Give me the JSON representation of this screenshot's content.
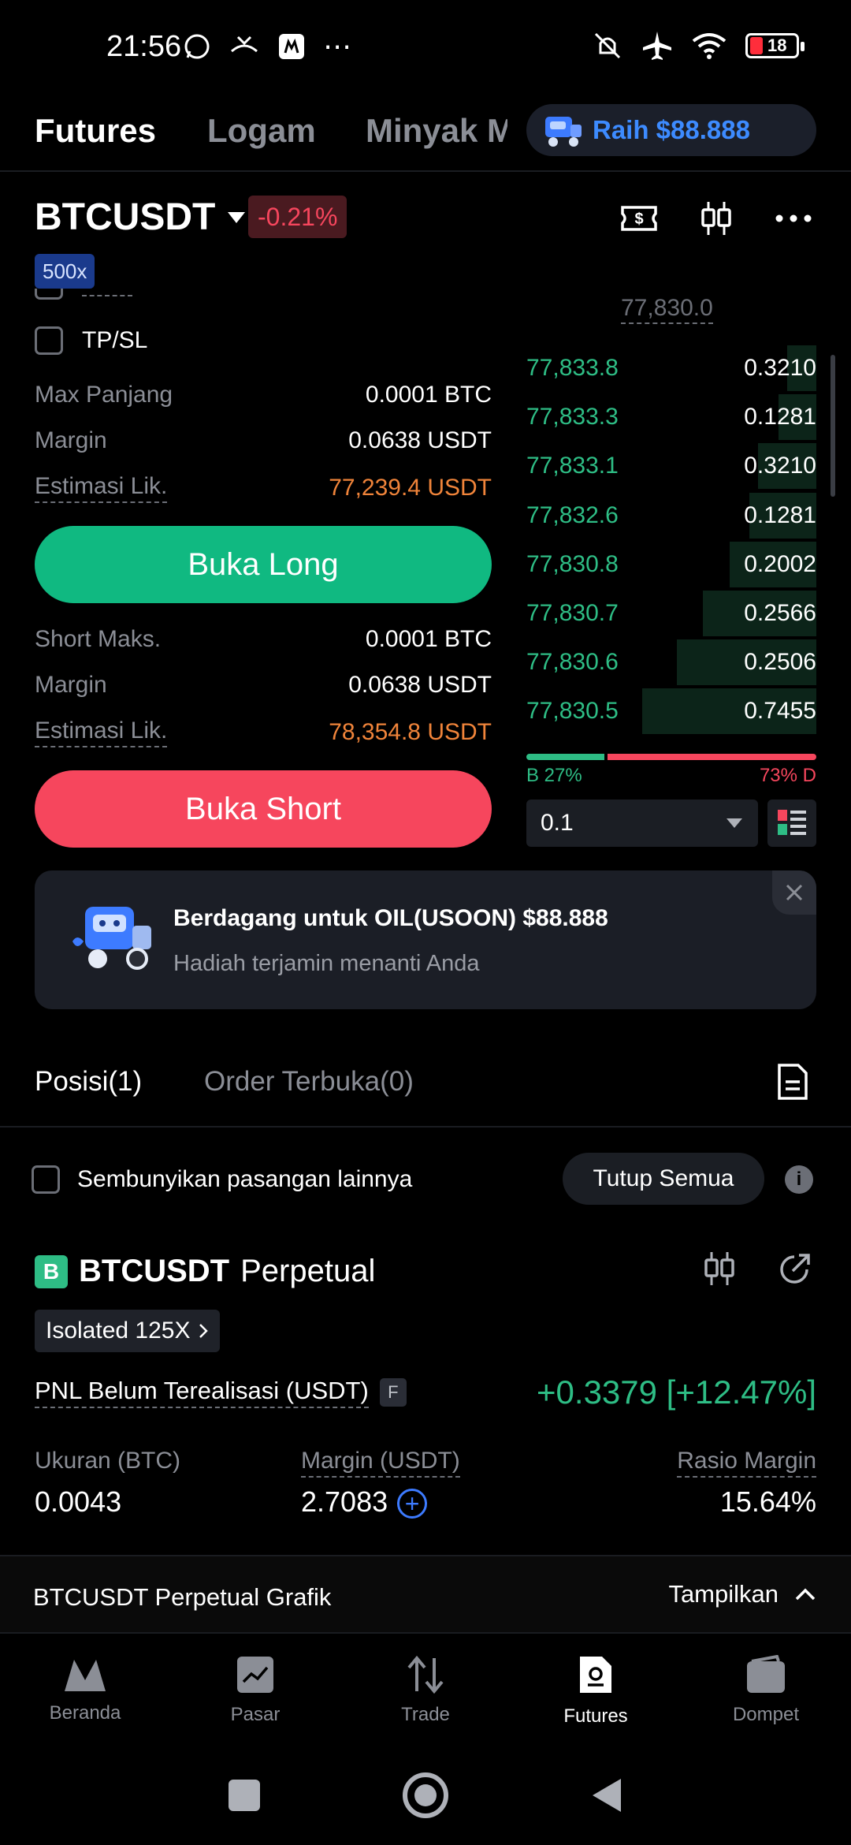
{
  "status_bar": {
    "time": "21:56",
    "battery": "18"
  },
  "top_tabs": {
    "tabs": [
      "Futures",
      "Logam",
      "Minyak M"
    ],
    "promo": "Raih $88.888"
  },
  "pair": {
    "symbol": "BTCUSDT",
    "change": "-0.21%",
    "leverage": "500x"
  },
  "form": {
    "tpsl_label": "TP/SL",
    "long": {
      "max_label": "Max Panjang",
      "max_value": "0.0001 BTC",
      "margin_label": "Margin",
      "margin_value": "0.0638 USDT",
      "liq_label": "Estimasi Lik.",
      "liq_value": "77,239.4 USDT",
      "button": "Buka Long"
    },
    "short": {
      "max_label": "Short Maks.",
      "max_value": "0.0001 BTC",
      "margin_label": "Margin",
      "margin_value": "0.0638 USDT",
      "liq_label": "Estimasi Lik.",
      "liq_value": "78,354.8 USDT",
      "button": "Buka Short"
    }
  },
  "orderbook": {
    "last_price": "77,830.0",
    "rows": [
      {
        "price": "77,833.8",
        "qty": "0.3210",
        "depth": 0.1
      },
      {
        "price": "77,833.3",
        "qty": "0.1281",
        "depth": 0.13
      },
      {
        "price": "77,833.1",
        "qty": "0.3210",
        "depth": 0.2
      },
      {
        "price": "77,832.6",
        "qty": "0.1281",
        "depth": 0.23
      },
      {
        "price": "77,830.8",
        "qty": "0.2002",
        "depth": 0.3
      },
      {
        "price": "77,830.7",
        "qty": "0.2566",
        "depth": 0.39
      },
      {
        "price": "77,830.6",
        "qty": "0.2506",
        "depth": 0.48
      },
      {
        "price": "77,830.5",
        "qty": "0.7455",
        "depth": 0.6
      }
    ],
    "buy_ratio": 0.27,
    "buy_label": "B 27%",
    "sell_label": "73% D",
    "qty_step": "0.1"
  },
  "banner": {
    "title": "Berdagang untuk OIL(USOON) $88.888",
    "subtitle": "Hadiah terjamin menanti Anda"
  },
  "positions": {
    "tab_positions": "Posisi(1)",
    "tab_orders": "Order Terbuka(0)",
    "hide_pairs": "Sembunyikan pasangan lainnya",
    "close_all": "Tutup Semua",
    "card": {
      "badge": "B",
      "symbol": "BTCUSDT",
      "type": "Perpetual",
      "isolated": "Isolated 125X",
      "pnl_label": "PNL Belum Terealisasi (USDT)",
      "pnl_badge": "F",
      "pnl_value": "+0.3379 [+12.47%]",
      "size_label": "Ukuran (BTC)",
      "size_value": "0.0043",
      "margin_label": "Margin (USDT)",
      "margin_value": "2.7083",
      "ratio_label": "Rasio Margin",
      "ratio_value": "15.64%"
    }
  },
  "chart_bar": {
    "title": "BTCUSDT Perpetual Grafik",
    "toggle": "Tampilkan"
  },
  "bottom_nav": [
    "Beranda",
    "Pasar",
    "Trade",
    "Futures",
    "Dompet"
  ]
}
